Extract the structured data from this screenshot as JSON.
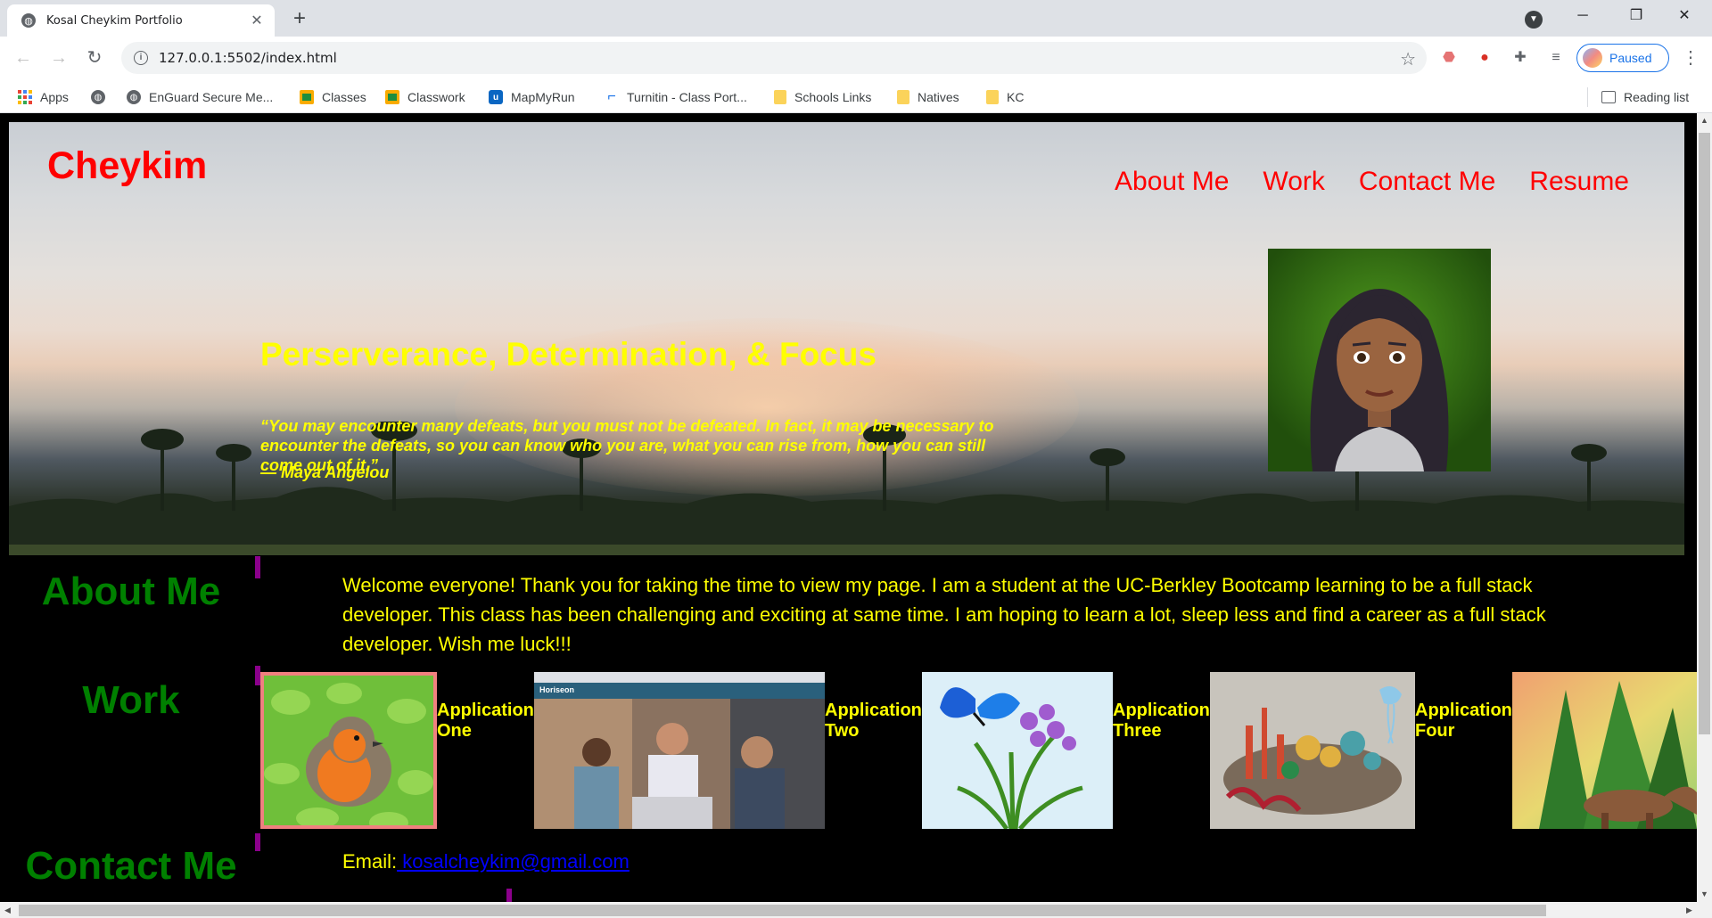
{
  "browser": {
    "tab_title": "Kosal Cheykim Portfolio",
    "url": "127.0.0.1:5502/index.html",
    "profile_status": "Paused",
    "bookmarks": [
      {
        "label": "Apps",
        "icon": "apps-icon"
      },
      {
        "label": "",
        "icon": "globe-icon"
      },
      {
        "label": "EnGuard Secure Me...",
        "icon": "globe-icon"
      },
      {
        "label": "Classes",
        "icon": "classroom-icon"
      },
      {
        "label": "Classwork",
        "icon": "classroom-icon"
      },
      {
        "label": "MapMyRun",
        "icon": "mapmyrun-icon"
      },
      {
        "label": "Turnitin - Class Port...",
        "icon": "turnitin-icon"
      },
      {
        "label": "Schools Links",
        "icon": "folder-icon"
      },
      {
        "label": "Natives",
        "icon": "folder-icon"
      },
      {
        "label": "KC",
        "icon": "folder-icon"
      }
    ],
    "reading_list": "Reading list"
  },
  "page": {
    "brand": "Cheykim",
    "nav": [
      "About Me",
      "Work",
      "Contact Me",
      "Resume"
    ],
    "headline": "Perserverance, Determination, & Focus",
    "quote": "“You may encounter many defeats, but you must not be defeated. In fact, it may be necessary to encounter the defeats, so you can know who you are, what you can rise from, how you can still come out of it.”",
    "quote_author": "— Maya Angelou",
    "about": {
      "title": "About Me",
      "text": "Welcome everyone! Thank you for taking the time to view my page. I am a student at the UC-Berkley Bootcamp learning to be a full stack developer. This class has been challenging and exciting at same time. I am hoping to learn a lot, sleep less and find a career as a full stack developer. Wish me luck!!!"
    },
    "work": {
      "title": "Work",
      "apps": [
        {
          "line1": "Application",
          "line2": "One"
        },
        {
          "line1": "Application",
          "line2": "Two"
        },
        {
          "line1": "Application",
          "line2": "Three"
        },
        {
          "line1": "Application",
          "line2": "Four"
        }
      ],
      "horiseon_brand": "Horiseon"
    },
    "contact": {
      "title": "Contact Me",
      "email_label": "Email:",
      "email": " kosalcheykim@gmail.com"
    }
  },
  "colors": {
    "brand": "#ff0000",
    "headline": "#ffff00",
    "section_title": "#008000",
    "rule": "#8b008b",
    "link": "#0000ff"
  }
}
